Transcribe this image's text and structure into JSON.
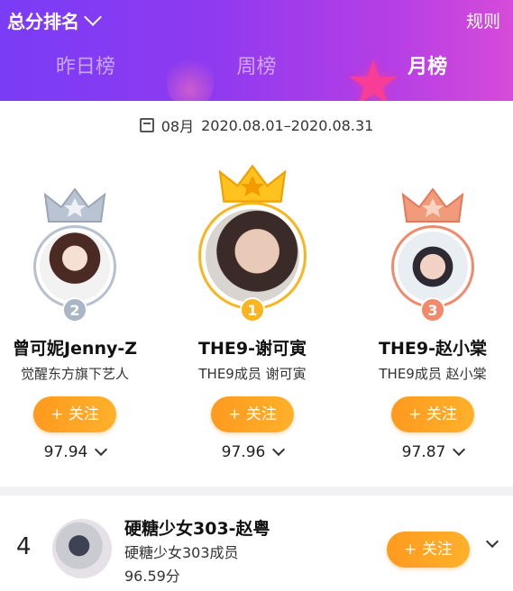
{
  "header": {
    "title": "总分排名",
    "rules_label": "规则",
    "tabs": [
      {
        "label": "昨日榜",
        "active": false
      },
      {
        "label": "周榜",
        "active": false
      },
      {
        "label": "月榜",
        "active": true
      }
    ]
  },
  "period": {
    "month": "08月",
    "range": "2020.08.01–2020.08.31"
  },
  "podium": [
    {
      "rank": "2",
      "name": "曾可妮Jenny-Z",
      "desc": "觉醒东方旗下艺人",
      "follow_label": "+ 关注",
      "score": "97.94",
      "color": "#a9b4c4"
    },
    {
      "rank": "1",
      "name": "THE9-谢可寅",
      "desc": "THE9成员 谢可寅",
      "follow_label": "+ 关注",
      "score": "97.96",
      "color": "#f7b51f"
    },
    {
      "rank": "3",
      "name": "THE9-赵小棠",
      "desc": "THE9成员 赵小棠",
      "follow_label": "+ 关注",
      "score": "97.87",
      "color": "#f08a6b"
    }
  ],
  "list": [
    {
      "rank": "4",
      "name": "硬糖少女303-赵粤",
      "desc": "硬糖少女303成员",
      "score": "96.59分",
      "follow_label": "+ 关注"
    }
  ],
  "colors": {
    "accent": "#ffa623",
    "header_start": "#7a3cf5",
    "header_end": "#d64bd9"
  }
}
